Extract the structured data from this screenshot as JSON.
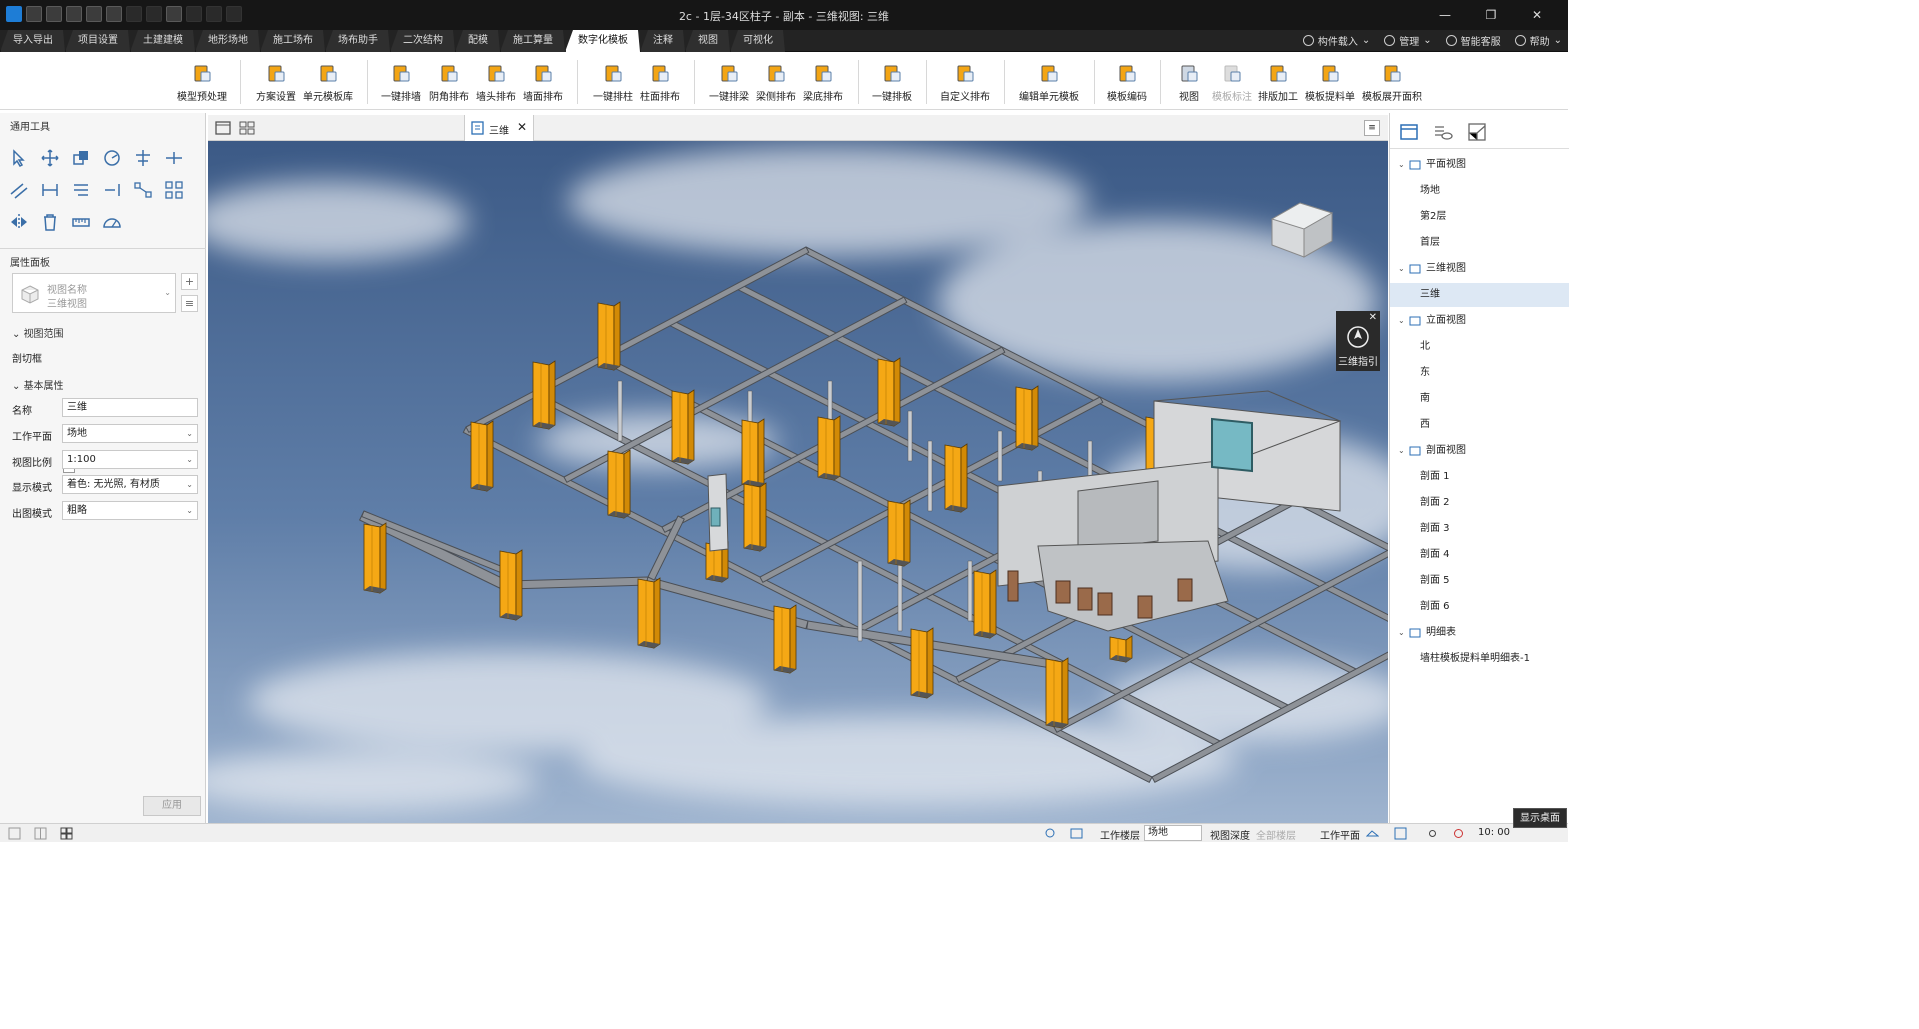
{
  "window": {
    "title": "2c - 1层-34区柱子 - 副本 - 三维视图: 三维",
    "controls": [
      "—",
      "❐",
      "✕"
    ]
  },
  "menu_tabs": [
    "导入导出",
    "项目设置",
    "土建建模",
    "地形场地",
    "施工场布",
    "场布助手",
    "二次结构",
    "配模",
    "施工算量",
    "数字化模板",
    "注释",
    "视图",
    "可视化"
  ],
  "active_tab": "数字化模板",
  "right_tools": {
    "component_load": "构件载入",
    "manage": "管理",
    "support": "智能客服",
    "help": "帮助"
  },
  "ribbon": {
    "items": [
      {
        "label": "模型预处理"
      },
      {
        "label": "方案设置"
      },
      {
        "label": "单元模板库"
      },
      {
        "label": "一键排墙"
      },
      {
        "label": "阴角排布"
      },
      {
        "label": "墙头排布"
      },
      {
        "label": "墙面排布"
      },
      {
        "label": "一键排柱"
      },
      {
        "label": "柱面排布"
      },
      {
        "label": "一键排梁"
      },
      {
        "label": "梁侧排布"
      },
      {
        "label": "梁底排布"
      },
      {
        "label": "一键排板"
      },
      {
        "label": "自定义排布"
      },
      {
        "label": "编辑单元模板"
      },
      {
        "label": "模板编码"
      },
      {
        "label": "视图"
      },
      {
        "label": "模板标注"
      },
      {
        "label": "排版加工"
      },
      {
        "label": "模板提料单"
      },
      {
        "label": "模板展开面积"
      }
    ]
  },
  "left_panel": {
    "tools_title": "通用工具",
    "props_title": "属性面板",
    "view_name_label": "视图名称",
    "view_name_value": "三维视图",
    "section_range": "视图范围",
    "crop_label": "剖切框",
    "section_basic": "基本属性",
    "fields": [
      {
        "label": "名称",
        "value": "三维"
      },
      {
        "label": "工作平面",
        "value": "场地"
      },
      {
        "label": "视图比例",
        "value": "1:100"
      },
      {
        "label": "显示模式",
        "value": "着色: 无光照, 有材质"
      },
      {
        "label": "出图模式",
        "value": "粗略"
      }
    ],
    "apply": "应用"
  },
  "view_tab": {
    "label": "三维",
    "close": "✕"
  },
  "viewport": {
    "guide_label": "三维指引",
    "guide_close": "✕",
    "colors": {
      "sky_top": "#3c5a86",
      "sky_bottom": "#9fb4cf",
      "column": "#f5a815",
      "frame": "#8e9298"
    }
  },
  "right_panel": {
    "tree": [
      {
        "label": "平面视图",
        "level": 0
      },
      {
        "label": "场地",
        "level": 1
      },
      {
        "label": "第2层",
        "level": 1
      },
      {
        "label": "首层",
        "level": 1
      },
      {
        "label": "三维视图",
        "level": 0
      },
      {
        "label": "三维",
        "level": 1,
        "selected": true
      },
      {
        "label": "立面视图",
        "level": 0
      },
      {
        "label": "北",
        "level": 1
      },
      {
        "label": "东",
        "level": 1
      },
      {
        "label": "南",
        "level": 1
      },
      {
        "label": "西",
        "level": 1
      },
      {
        "label": "剖面视图",
        "level": 0
      },
      {
        "label": "剖面 1",
        "level": 1
      },
      {
        "label": "剖面 2",
        "level": 1
      },
      {
        "label": "剖面 3",
        "level": 1
      },
      {
        "label": "剖面 4",
        "level": 1
      },
      {
        "label": "剖面 5",
        "level": 1
      },
      {
        "label": "剖面 6",
        "level": 1
      },
      {
        "label": "明细表",
        "level": 0
      },
      {
        "label": "墙柱模板提料单明细表-1",
        "level": 1
      }
    ]
  },
  "status": {
    "work_floor_label": "工作楼层",
    "work_floor_value": "场地",
    "view_depth_label": "视图深度",
    "view_depth_value": "全部楼层",
    "work_plane_label": "工作平面",
    "time": "10: 00"
  },
  "tooltip": "显示桌面"
}
